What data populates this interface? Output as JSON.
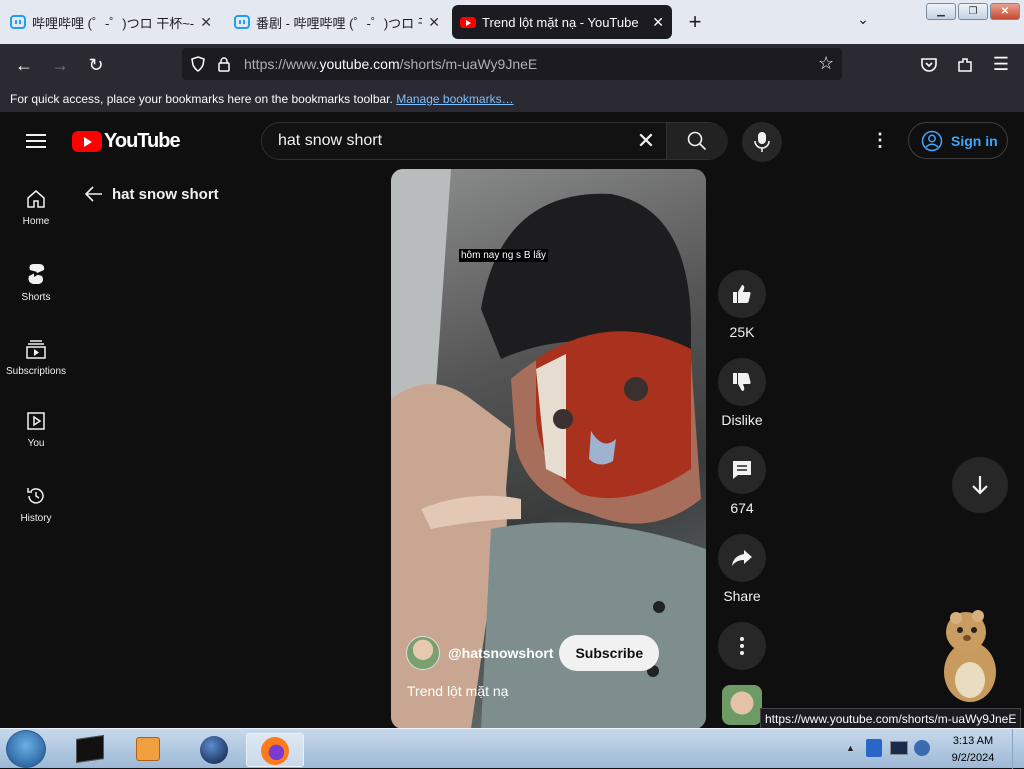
{
  "browser": {
    "tabs": [
      {
        "title": "哔哩哔哩 (゜-゜)つロ 干杯~-bilibili",
        "icon": "bilibili-icon",
        "active": false
      },
      {
        "title": "番剧 - 哔哩哔哩 (゜-゜)つロ 干杯~-bilibili",
        "icon": "bilibili-icon",
        "active": false
      },
      {
        "title": "Trend lột mặt nạ - YouTube",
        "icon": "youtube-icon",
        "active": true
      }
    ],
    "url_prefix": "https://www.",
    "url_domain": "youtube.com",
    "url_path": "/shorts/m-uaWy9JneE",
    "bookmarks_text": "For quick access, place your bookmarks here on the bookmarks toolbar.",
    "bookmarks_link": "Manage bookmarks…",
    "status_url": "https://www.youtube.com/shorts/m-uaWy9JneE"
  },
  "youtube": {
    "logo_text": "YouTube",
    "search_value": "hat snow short",
    "sign_in": "Sign in",
    "back_label": "hat snow short",
    "sidebar": [
      {
        "label": "Home",
        "icon": "home-icon"
      },
      {
        "label": "Shorts",
        "icon": "shorts-icon"
      },
      {
        "label": "Subscriptions",
        "icon": "subscriptions-icon"
      },
      {
        "label": "You",
        "icon": "you-icon"
      },
      {
        "label": "History",
        "icon": "history-icon"
      }
    ],
    "short": {
      "caption": "hôm nay ng s B lấy",
      "channel": "@hatsnowshort",
      "subscribe": "Subscribe",
      "title": "Trend lột mặt nạ",
      "likes": "25K",
      "dislike": "Dislike",
      "comments": "674",
      "share": "Share"
    }
  },
  "taskbar": {
    "time": "3:13 AM",
    "date": "9/2/2024"
  },
  "colors": {
    "accent": "#3ea6ff",
    "youtube_red": "#ff0000",
    "bg": "#0f0f0f"
  }
}
